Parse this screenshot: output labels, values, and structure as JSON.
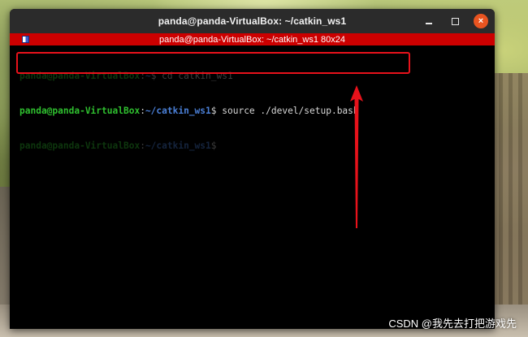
{
  "window": {
    "title": "panda@panda-VirtualBox: ~/catkin_ws1",
    "controls": {
      "minimize": "minimize",
      "maximize": "maximize",
      "close": "×"
    }
  },
  "terminal": {
    "inner_title": "panda@panda-VirtualBox: ~/catkin_ws1 80x24",
    "lines": [
      {
        "user": "panda@panda-VirtualBox",
        "sep": ":",
        "path": "~",
        "prompt": "$",
        "command": " cd catkin_ws1"
      },
      {
        "user": "panda@panda-VirtualBox",
        "sep": ":",
        "path": "~/catkin_ws1",
        "prompt": "$",
        "command": " source ./devel/setup.bash"
      },
      {
        "user": "panda@panda-VirtualBox",
        "sep": ":",
        "path": "~/catkin_ws1",
        "prompt": "$",
        "command": ""
      }
    ]
  },
  "annotation": {
    "highlight_color": "#e8121b"
  },
  "watermark": {
    "text": "CSDN @我先去打把游戏先"
  },
  "colors": {
    "user": "#2fbf2f",
    "path": "#4a7fd6",
    "titlebar": "#2b2b2b",
    "inner_titlebar": "#cc0000",
    "close_button": "#e95420"
  }
}
